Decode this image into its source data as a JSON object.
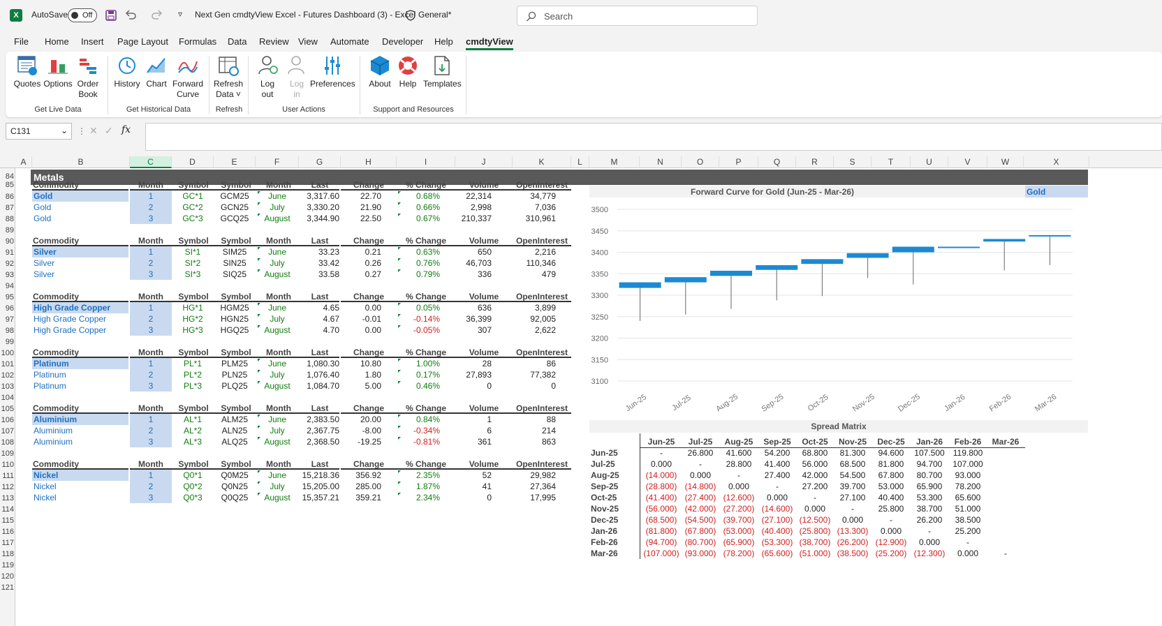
{
  "titlebar": {
    "app_icon": "X",
    "autosave_label": "AutoSave",
    "autosave_state": "Off",
    "doc_title": "Next Gen cmdtyView Excel - Futures Dashboard (3) -  Excel",
    "sensitivity": "General*",
    "search_placeholder": "Search"
  },
  "menu": [
    "File",
    "Home",
    "Insert",
    "Page Layout",
    "Formulas",
    "Data",
    "Review",
    "View",
    "Automate",
    "Developer",
    "Help",
    "cmdtyView"
  ],
  "ribbon": {
    "buttons": [
      {
        "label": "Quotes",
        "line2": "",
        "icon": "quotes-icon"
      },
      {
        "label": "Options",
        "line2": "",
        "icon": "options-icon"
      },
      {
        "label": "Order",
        "line2": "Book",
        "icon": "order-book-icon"
      },
      {
        "label": "History",
        "line2": "",
        "icon": "history-icon"
      },
      {
        "label": "Chart",
        "line2": "",
        "icon": "chart-icon"
      },
      {
        "label": "Forward",
        "line2": "Curve",
        "icon": "forward-curve-icon"
      },
      {
        "label": "Refresh",
        "line2": "Data ˅",
        "icon": "refresh-icon"
      },
      {
        "label": "Log",
        "line2": "out",
        "icon": "logout-icon"
      },
      {
        "label": "Log",
        "line2": "in",
        "icon": "login-icon"
      },
      {
        "label": "Preferences",
        "line2": "",
        "icon": "preferences-icon"
      },
      {
        "label": "About",
        "line2": "",
        "icon": "about-icon"
      },
      {
        "label": "Help",
        "line2": "",
        "icon": "help-icon"
      },
      {
        "label": "Templates",
        "line2": "",
        "icon": "templates-icon"
      }
    ],
    "groups": [
      "Get Live Data",
      "Get Historical Data",
      "Refresh",
      "User Actions",
      "Support and Resources"
    ]
  },
  "formula_bar": {
    "name_box": "C131",
    "fx": "fx"
  },
  "columns": [
    "A",
    "B",
    "C",
    "D",
    "E",
    "F",
    "G",
    "H",
    "I",
    "J",
    "K",
    "L",
    "M",
    "N",
    "O",
    "P",
    "Q",
    "R",
    "S",
    "T",
    "U",
    "V",
    "W",
    "X"
  ],
  "rows": [
    "84",
    "85",
    "86",
    "87",
    "88",
    "89",
    "90",
    "91",
    "92",
    "93",
    "94",
    "95",
    "96",
    "97",
    "98",
    "99",
    "100",
    "101",
    "102",
    "103",
    "104",
    "105",
    "106",
    "107",
    "108",
    "109",
    "110",
    "111",
    "112",
    "113",
    "114",
    "115",
    "116",
    "117",
    "118",
    "119",
    "120",
    "121"
  ],
  "section_title": "Metals",
  "table_headers": [
    "Commodity",
    "Month",
    "Symbol",
    "Symbol",
    "Month",
    "Last",
    "Change",
    "% Change",
    "Volume",
    "OpenInterest"
  ],
  "blocks": [
    {
      "rows": [
        [
          "Gold",
          "1",
          "GC*1",
          "GCM25",
          "June",
          "3,317.60",
          "22.70",
          "0.68%",
          "22,314",
          "34,779"
        ],
        [
          "Gold",
          "2",
          "GC*2",
          "GCN25",
          "July",
          "3,330.20",
          "21.90",
          "0.66%",
          "2,998",
          "7,036"
        ],
        [
          "Gold",
          "3",
          "GC*3",
          "GCQ25",
          "August",
          "3,344.90",
          "22.50",
          "0.67%",
          "210,337",
          "310,961"
        ]
      ]
    },
    {
      "rows": [
        [
          "Silver",
          "1",
          "SI*1",
          "SIM25",
          "June",
          "33.23",
          "0.21",
          "0.63%",
          "650",
          "2,216"
        ],
        [
          "Silver",
          "2",
          "SI*2",
          "SIN25",
          "July",
          "33.42",
          "0.26",
          "0.76%",
          "46,703",
          "110,346"
        ],
        [
          "Silver",
          "3",
          "SI*3",
          "SIQ25",
          "August",
          "33.58",
          "0.27",
          "0.79%",
          "336",
          "479"
        ]
      ]
    },
    {
      "rows": [
        [
          "High Grade Copper",
          "1",
          "HG*1",
          "HGM25",
          "June",
          "4.65",
          "0.00",
          "0.05%",
          "636",
          "3,899"
        ],
        [
          "High Grade Copper",
          "2",
          "HG*2",
          "HGN25",
          "July",
          "4.67",
          "-0.01",
          "-0.14%",
          "36,399",
          "92,005"
        ],
        [
          "High Grade Copper",
          "3",
          "HG*3",
          "HGQ25",
          "August",
          "4.70",
          "0.00",
          "-0.05%",
          "307",
          "2,622"
        ]
      ]
    },
    {
      "rows": [
        [
          "Platinum",
          "1",
          "PL*1",
          "PLM25",
          "June",
          "1,080.30",
          "10.80",
          "1.00%",
          "28",
          "86"
        ],
        [
          "Platinum",
          "2",
          "PL*2",
          "PLN25",
          "July",
          "1,076.40",
          "1.80",
          "0.17%",
          "27,893",
          "77,382"
        ],
        [
          "Platinum",
          "3",
          "PL*3",
          "PLQ25",
          "August",
          "1,084.70",
          "5.00",
          "0.46%",
          "0",
          "0"
        ]
      ]
    },
    {
      "rows": [
        [
          "Aluminium",
          "1",
          "AL*1",
          "ALM25",
          "June",
          "2,383.50",
          "20.00",
          "0.84%",
          "1",
          "88"
        ],
        [
          "Aluminium",
          "2",
          "AL*2",
          "ALN25",
          "July",
          "2,367.75",
          "-8.00",
          "-0.34%",
          "6",
          "214"
        ],
        [
          "Aluminium",
          "3",
          "AL*3",
          "ALQ25",
          "August",
          "2,368.50",
          "-19.25",
          "-0.81%",
          "361",
          "863"
        ]
      ]
    },
    {
      "rows": [
        [
          "Nickel",
          "1",
          "Q0*1",
          "Q0M25",
          "June",
          "15,218.36",
          "356.92",
          "2.35%",
          "52",
          "29,982"
        ],
        [
          "Nickel",
          "2",
          "Q0*2",
          "Q0N25",
          "July",
          "15,205.00",
          "285.00",
          "1.87%",
          "41",
          "27,364"
        ],
        [
          "Nickel",
          "3",
          "Q0*3",
          "Q0Q25",
          "August",
          "15,357.21",
          "359.21",
          "2.34%",
          "0",
          "17,995"
        ]
      ]
    }
  ],
  "forward_curve": {
    "title": "Forward Curve for Gold (Jun-25 - Mar-26)",
    "selector": "Gold"
  },
  "chart_data": {
    "type": "candlestick",
    "title": "Forward Curve for Gold (Jun-25 - Mar-26)",
    "categories": [
      "Jun-25",
      "Jul-25",
      "Aug-25",
      "Sep-25",
      "Oct-25",
      "Nov-25",
      "Dec-25",
      "Jan-26",
      "Feb-26",
      "Mar-26"
    ],
    "open": [
      3317,
      3330,
      3345,
      3359,
      3373,
      3387,
      3400,
      3412,
      3425,
      3437
    ],
    "close": [
      3330,
      3342,
      3357,
      3370,
      3384,
      3398,
      3413,
      3413,
      3431,
      3440
    ],
    "high": [
      3330,
      3342,
      3357,
      3370,
      3384,
      3398,
      3413,
      3413,
      3431,
      3440
    ],
    "low": [
      3240,
      3255,
      3268,
      3288,
      3298,
      3340,
      3325,
      3413,
      3358,
      3370
    ],
    "yticks": [
      3100,
      3150,
      3200,
      3250,
      3300,
      3350,
      3400,
      3450,
      3500
    ],
    "ylim": [
      3100,
      3500
    ],
    "grid": true,
    "color": "#1b8ad3"
  },
  "spread_matrix": {
    "title": "Spread Matrix",
    "headers": [
      "Jun-25",
      "Jul-25",
      "Aug-25",
      "Sep-25",
      "Oct-25",
      "Nov-25",
      "Dec-25",
      "Jan-26",
      "Feb-26",
      "Mar-26"
    ],
    "rows": [
      {
        "label": "Jun-25",
        "vals": [
          "-",
          "26.800",
          "41.600",
          "54.200",
          "68.800",
          "81.300",
          "94.600",
          "107.500",
          "119.800",
          ""
        ]
      },
      {
        "label": "Jul-25",
        "vals": [
          "0.000",
          "-",
          "28.800",
          "41.400",
          "56.000",
          "68.500",
          "81.800",
          "94.700",
          "107.000",
          ""
        ]
      },
      {
        "label": "Aug-25",
        "vals": [
          "(14.000)",
          "0.000",
          "-",
          "27.400",
          "42.000",
          "54.500",
          "67.800",
          "80.700",
          "93.000",
          ""
        ]
      },
      {
        "label": "Sep-25",
        "vals": [
          "(28.800)",
          "(14.800)",
          "0.000",
          "-",
          "27.200",
          "39.700",
          "53.000",
          "65.900",
          "78.200",
          ""
        ]
      },
      {
        "label": "Oct-25",
        "vals": [
          "(41.400)",
          "(27.400)",
          "(12.600)",
          "0.000",
          "-",
          "27.100",
          "40.400",
          "53.300",
          "65.600",
          ""
        ]
      },
      {
        "label": "Nov-25",
        "vals": [
          "(56.000)",
          "(42.000)",
          "(27.200)",
          "(14.600)",
          "0.000",
          "-",
          "25.800",
          "38.700",
          "51.000",
          ""
        ]
      },
      {
        "label": "Dec-25",
        "vals": [
          "(68.500)",
          "(54.500)",
          "(39.700)",
          "(27.100)",
          "(12.500)",
          "0.000",
          "-",
          "26.200",
          "38.500",
          ""
        ]
      },
      {
        "label": "Jan-26",
        "vals": [
          "(81.800)",
          "(67.800)",
          "(53.000)",
          "(40.400)",
          "(25.800)",
          "(13.300)",
          "0.000",
          "-",
          "25.200",
          ""
        ]
      },
      {
        "label": "Feb-26",
        "vals": [
          "(94.700)",
          "(80.700)",
          "(65.900)",
          "(53.300)",
          "(38.700)",
          "(26.200)",
          "(12.900)",
          "0.000",
          "-",
          ""
        ]
      },
      {
        "label": "Mar-26",
        "vals": [
          "(107.000)",
          "(93.000)",
          "(78.200)",
          "(65.600)",
          "(51.000)",
          "(38.500)",
          "(25.200)",
          "(12.300)",
          "0.000",
          "-"
        ]
      }
    ]
  },
  "colors": {
    "accent": "#107c41",
    "link_blue": "#1f6fbf",
    "up_green": "#107c10",
    "down_red": "#d21f1f",
    "section_bg": "#595959"
  }
}
